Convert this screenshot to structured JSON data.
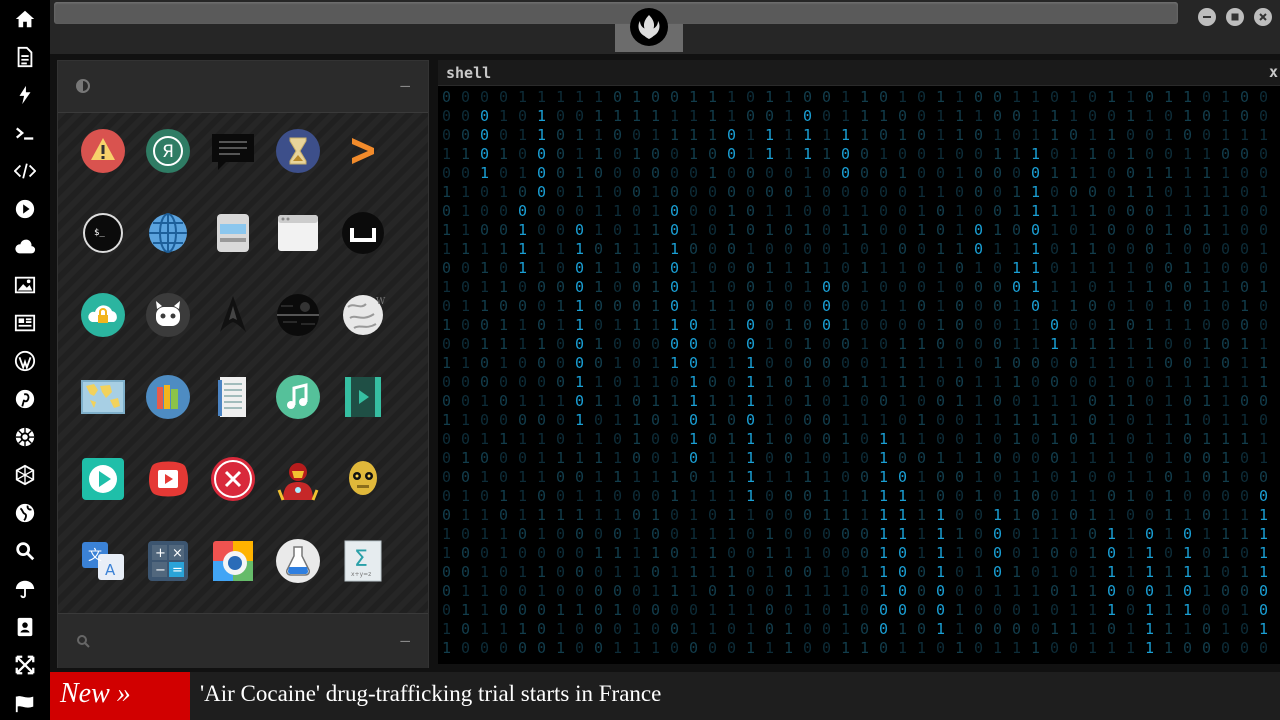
{
  "dock": {
    "items": [
      "home-icon",
      "document-icon",
      "bolt-icon",
      "terminal-icon",
      "code-icon",
      "play-icon",
      "cloud-icon",
      "image-icon",
      "news-icon",
      "wordpress-icon",
      "pinterest-icon",
      "gear-network-icon",
      "globe-mesh-icon",
      "globe-icon",
      "search-icon",
      "umbrella-icon",
      "contacts-icon",
      "expand-icon",
      "flag-icon"
    ]
  },
  "window": {
    "controls": [
      "minimize-icon",
      "maximize-icon",
      "close-icon"
    ]
  },
  "launcher": {
    "apps": [
      [
        "warning-icon",
        "yandex-icon",
        "chat-icon",
        "hourglass-icon",
        "sublime-icon"
      ],
      [
        "terminal-circle-icon",
        "globe-icon",
        "scanner-icon",
        "browser-window-icon",
        "ubuntu-icon"
      ],
      [
        "cloud-lock-icon",
        "github-icon",
        "starfleet-icon",
        "death-star-icon",
        "wikipedia-icon"
      ],
      [
        "world-map-icon",
        "books-icon",
        "notebook-icon",
        "music-icon",
        "video-icon"
      ],
      [
        "play-store-icon",
        "video-player-icon",
        "close-circle-icon",
        "iron-man-icon",
        "c3po-icon"
      ],
      [
        "translate-icon",
        "calculator-icon",
        "photo-viewer-icon",
        "flask-icon",
        "math-sigma-icon"
      ]
    ],
    "minimize_label": "–"
  },
  "shell": {
    "title": "shell",
    "close_label": "x"
  },
  "ticker": {
    "badge": "New »",
    "headline": "'Air Cocaine' drug-trafficking trial starts in France"
  },
  "colors": {
    "matrix_bright": "#1a9fd4",
    "matrix_dim": "#0d2c38",
    "ticker_red": "#d10000"
  }
}
